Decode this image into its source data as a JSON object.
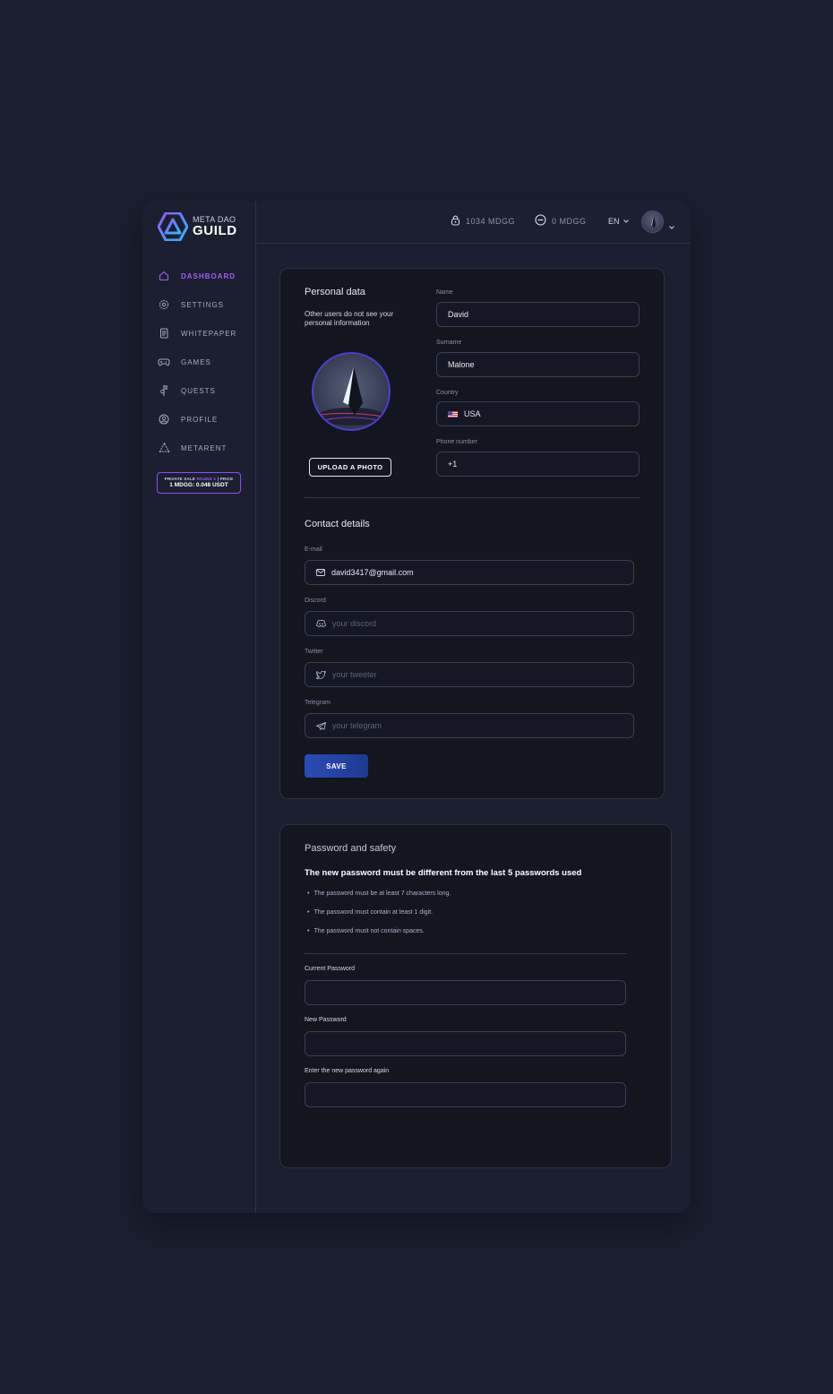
{
  "brand": {
    "top": "META DAO",
    "bottom": "GUILD"
  },
  "nav": [
    {
      "label": "DASHBOARD",
      "icon": "home-icon",
      "active": true
    },
    {
      "label": "SETTINGS",
      "icon": "gear-icon"
    },
    {
      "label": "WHITEPAPER",
      "icon": "document-icon"
    },
    {
      "label": "GAMES",
      "icon": "gamepad-icon"
    },
    {
      "label": "QUESTS",
      "icon": "quest-icon"
    },
    {
      "label": "PROFILE",
      "icon": "profile-icon"
    },
    {
      "label": "METARENT",
      "icon": "metarent-icon"
    }
  ],
  "promo": {
    "prefix": "PRIVATE SALE",
    "round": "ROUND 1",
    "suffix": "PRICE",
    "price": "1 MDGG: 0.048 USDT"
  },
  "topbar": {
    "locked_balance": "1034 MDGG",
    "wallet_balance": "0 MDGG",
    "language": "EN"
  },
  "personal": {
    "title": "Personal data",
    "note": "Other users do not see your personal information",
    "upload_label": "UPLOAD A PHOTO",
    "name_label": "Name",
    "name_value": "David",
    "surname_label": "Surname",
    "surname_value": "Malone",
    "country_label": "Country",
    "country_value": "USA",
    "phone_label": "Phone number",
    "phone_value": "+1"
  },
  "contact": {
    "title": "Contact details",
    "email_label": "E-mail",
    "email_value": "david3417@gmail.com",
    "discord_label": "Discord",
    "discord_placeholder": "your discord",
    "twitter_label": "Twitter",
    "twitter_placeholder": "your tweeter",
    "telegram_label": "Telegram",
    "telegram_placeholder": "your telegram",
    "save_label": "SAVE"
  },
  "security": {
    "title": "Password and safety",
    "subtitle": "The new password must be different from the last 5 passwords used",
    "rules": [
      "The password must be at least 7 characters long.",
      "The password must contain at least 1 digit.",
      "The password must not contain spaces."
    ],
    "current_label": "Current Password",
    "new_label": "New Password",
    "repeat_label": "Enter the new password again"
  },
  "colors": {
    "accent": "#a35bff",
    "primary_button": "#2a4bb5",
    "background": "#1b1e2e",
    "card": "#13151f"
  }
}
